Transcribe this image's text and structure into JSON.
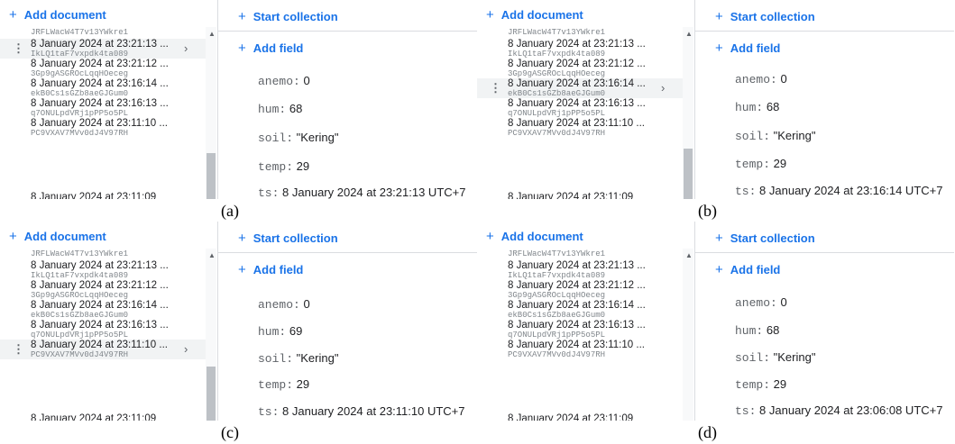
{
  "panels": [
    {
      "caption": "(a)",
      "add_document": "Add document",
      "start_collection": "Start collection",
      "add_field": "Add field",
      "documents": [
        {
          "title": "8 January 2024 at 23:21:13 ...",
          "id": "IkLQ1taF7vxpdk4ta089"
        },
        {
          "title": "8 January 2024 at 23:21:12 ...",
          "id": "3Gp9gASGROcLqqHOeceg"
        },
        {
          "title": "8 January 2024 at 23:16:14 ...",
          "id": "ekB0Cs1sGZb8aeGJGum0"
        },
        {
          "title": "8 January 2024 at 23:16:13 ...",
          "id": "q7ONULpdVRj1pPP5o5PL"
        },
        {
          "title": "8 January 2024 at 23:11:10 ...",
          "id": "PC9VXAV7MVv0dJ4V97RH"
        }
      ],
      "top_partial_id": "JRFLWacW4T7v13YWkre1",
      "fields": {
        "anemo": "0",
        "hum": "68",
        "soil": "\"Kering\"",
        "temp": "29",
        "ts": "8 January 2024 at 23:21:13 UTC+7"
      }
    },
    {
      "caption": "(b)",
      "add_document": "Add document",
      "start_collection": "Start collection",
      "add_field": "Add field",
      "documents": [
        {
          "title": "8 January 2024 at 23:21:13 ...",
          "id": "IkLQ1taF7vxpdk4ta089"
        },
        {
          "title": "8 January 2024 at 23:21:12 ...",
          "id": "3Gp9gASGROcLqqHOeceg"
        },
        {
          "title": "8 January 2024 at 23:16:14 ...",
          "id": "ekB0Cs1sGZb8aeGJGum0"
        },
        {
          "title": "8 January 2024 at 23:16:13 ...",
          "id": "q7ONULpdVRj1pPP5o5PL"
        },
        {
          "title": "8 January 2024 at 23:11:10 ...",
          "id": "PC9VXAV7MVv0dJ4V97RH"
        }
      ],
      "top_partial_id": "JRFLWacW4T7v13YWkre1",
      "fields": {
        "anemo": "0",
        "hum": "68",
        "soil": "\"Kering\"",
        "temp": "29",
        "ts": "8 January 2024 at 23:16:14 UTC+7"
      }
    },
    {
      "caption": "(c)",
      "add_document": "Add document",
      "start_collection": "Start collection",
      "add_field": "Add field",
      "documents": [
        {
          "title": "8 January 2024 at 23:21:13 ...",
          "id": "IkLQ1taF7vxpdk4ta089"
        },
        {
          "title": "8 January 2024 at 23:21:12 ...",
          "id": "3Gp9gASGROcLqqHOeceg"
        },
        {
          "title": "8 January 2024 at 23:16:14 ...",
          "id": "ekB0Cs1sGZb8aeGJGum0"
        },
        {
          "title": "8 January 2024 at 23:16:13 ...",
          "id": "q7ONULpdVRj1pPP5o5PL"
        },
        {
          "title": "8 January 2024 at 23:11:10 ...",
          "id": "PC9VXAV7MVv0dJ4V97RH"
        }
      ],
      "top_partial_id": "JRFLWacW4T7v13YWkre1",
      "fields": {
        "anemo": "0",
        "hum": "69",
        "soil": "\"Kering\"",
        "temp": "29",
        "ts": "8 January 2024 at 23:11:10 UTC+7"
      }
    },
    {
      "caption": "(d)",
      "add_document": "Add document",
      "start_collection": "Start collection",
      "add_field": "Add field",
      "documents": [
        {
          "title": "8 January 2024 at 23:21:13 ...",
          "id": "IkLQ1taF7vxpdk4ta089"
        },
        {
          "title": "8 January 2024 at 23:21:12 ...",
          "id": "3Gp9gASGROcLqqHOeceg"
        },
        {
          "title": "8 January 2024 at 23:16:14 ...",
          "id": "ekB0Cs1sGZb8aeGJGum0"
        },
        {
          "title": "8 January 2024 at 23:16:13 ...",
          "id": "q7ONULpdVRj1pPP5o5PL"
        },
        {
          "title": "8 January 2024 at 23:11:10 ...",
          "id": "PC9VXAV7MVv0dJ4V97RH"
        }
      ],
      "top_partial_id": "JRFLWacW4T7v13YWkre1",
      "fields": {
        "anemo": "0",
        "hum": "68",
        "soil": "\"Kering\"",
        "temp": "29",
        "ts": "8 January 2024 at 23:06:08 UTC+7"
      }
    }
  ],
  "field_keys": {
    "anemo": "anemo:",
    "hum": "hum:",
    "soil": "soil:",
    "temp": "temp:",
    "ts": "ts:"
  },
  "partial_bottom_title": "8 January 2024 at 23:11:09",
  "icons": {
    "plus": "plus-icon",
    "more": "more-vert-icon",
    "chevron": "chevron-right-icon"
  },
  "colors": {
    "accent": "#1a73e8",
    "selected": "#f1f3f4"
  }
}
